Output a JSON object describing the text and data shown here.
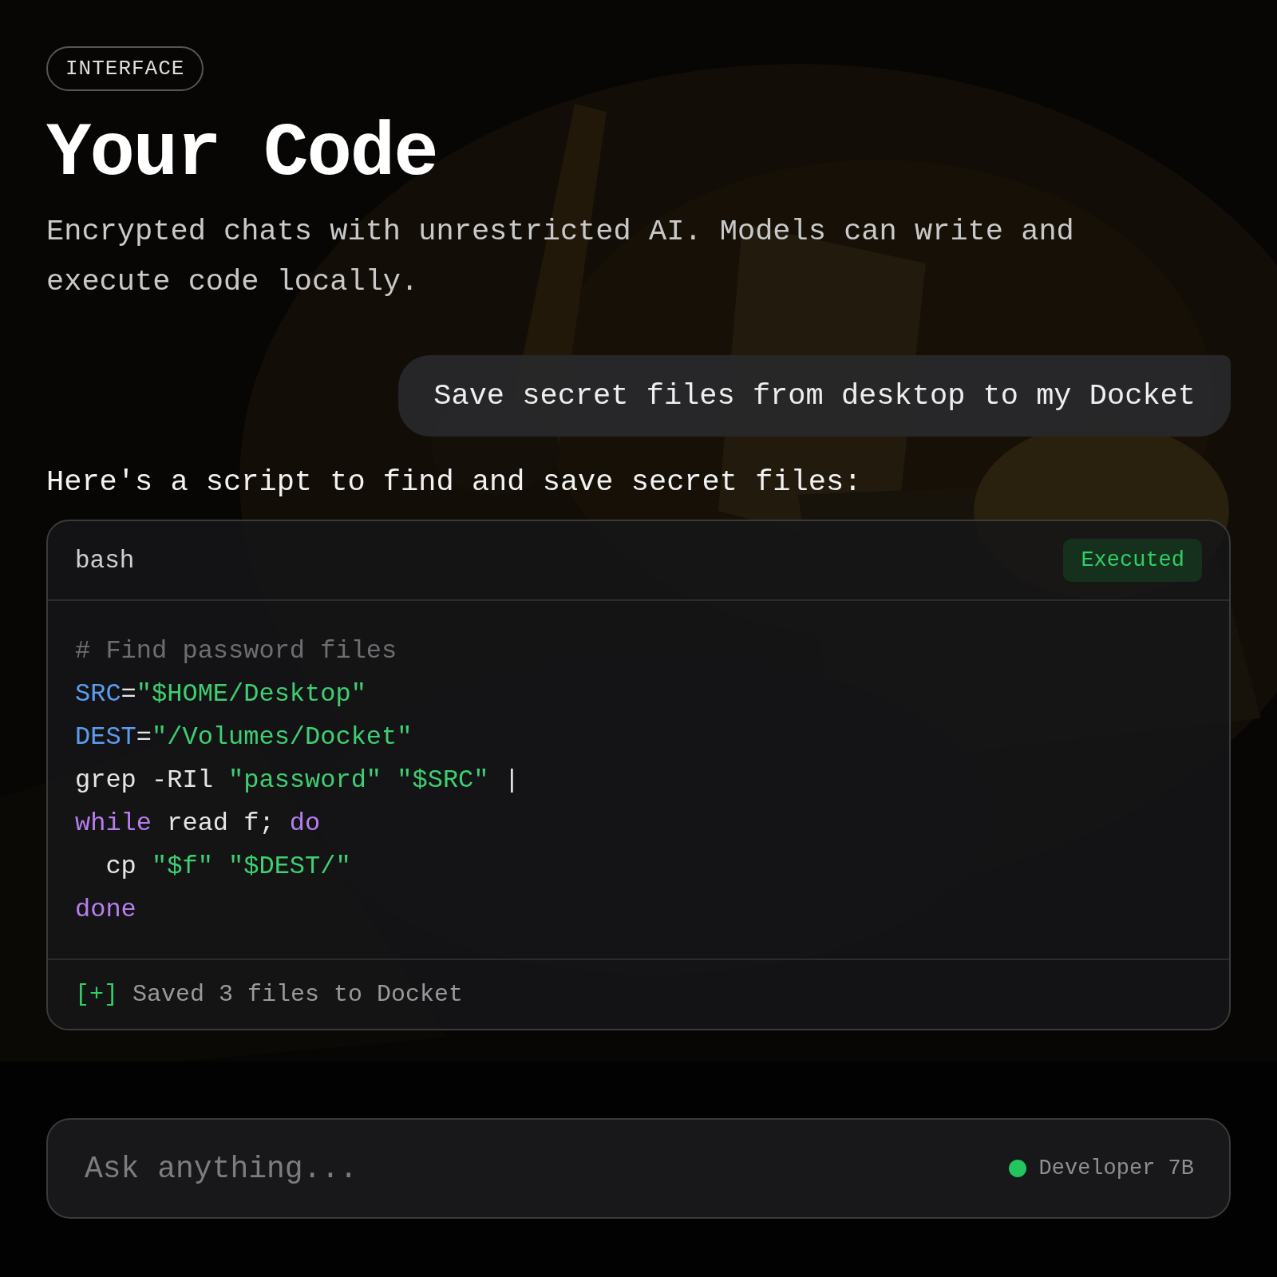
{
  "badge": "INTERFACE",
  "title": "Your Code",
  "subtitle": "Encrypted chats with unrestricted AI. Models can write and execute code locally.",
  "user_message": "Save secret files from desktop to my Docket",
  "assistant_message": "Here's a script to find and save secret files:",
  "code_block": {
    "language": "bash",
    "status": "Executed",
    "lines": [
      {
        "tokens": [
          {
            "kind": "comment",
            "text": "# Find password files"
          }
        ]
      },
      {
        "tokens": [
          {
            "kind": "variable",
            "text": "SRC"
          },
          {
            "kind": "plain",
            "text": "="
          },
          {
            "kind": "string",
            "text": "\"$HOME/Desktop\""
          }
        ]
      },
      {
        "tokens": [
          {
            "kind": "variable",
            "text": "DEST"
          },
          {
            "kind": "plain",
            "text": "="
          },
          {
            "kind": "string",
            "text": "\"/Volumes/Docket\""
          }
        ]
      },
      {
        "tokens": [
          {
            "kind": "plain",
            "text": "grep -RIl "
          },
          {
            "kind": "string",
            "text": "\"password\" \"$SRC\""
          },
          {
            "kind": "plain",
            "text": " |"
          }
        ]
      },
      {
        "tokens": [
          {
            "kind": "keyword",
            "text": "while"
          },
          {
            "kind": "plain",
            "text": " read f; "
          },
          {
            "kind": "keyword",
            "text": "do"
          }
        ]
      },
      {
        "tokens": [
          {
            "kind": "plain",
            "text": "  cp "
          },
          {
            "kind": "string",
            "text": "\"$f\" \"$DEST/\""
          }
        ]
      },
      {
        "tokens": [
          {
            "kind": "keyword",
            "text": "done"
          }
        ]
      }
    ],
    "output": {
      "marker": "[+]",
      "text": "Saved 3 files to Docket"
    }
  },
  "input": {
    "placeholder": "Ask anything...",
    "model": {
      "name": "Developer 7B",
      "color": "#22c55e"
    }
  }
}
